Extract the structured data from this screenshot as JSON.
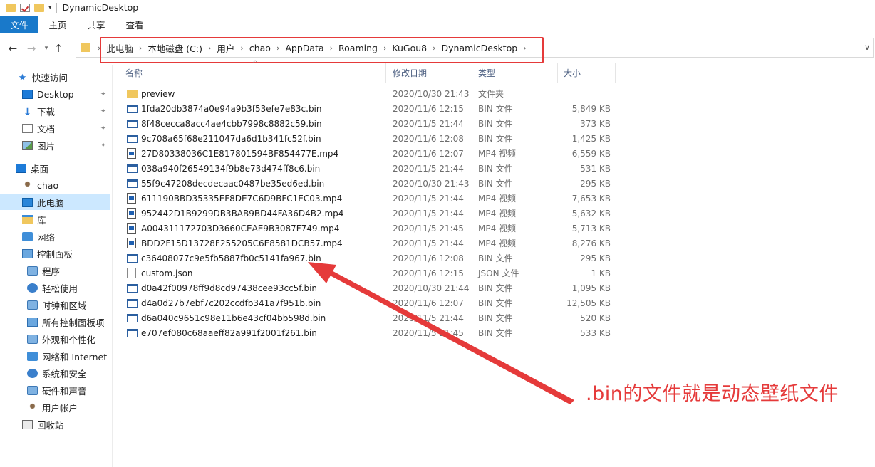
{
  "window": {
    "title": "DynamicDesktop"
  },
  "ribbon": {
    "tabs": [
      "文件",
      "主页",
      "共享",
      "查看"
    ]
  },
  "address": {
    "crumbs": [
      "此电脑",
      "本地磁盘 (C:)",
      "用户",
      "chao",
      "AppData",
      "Roaming",
      "KuGou8",
      "DynamicDesktop"
    ]
  },
  "sidebar": {
    "items": [
      "快速访问",
      "Desktop",
      "下载",
      "文档",
      "图片",
      "桌面",
      "chao",
      "此电脑",
      "库",
      "网络",
      "控制面板",
      "程序",
      "轻松使用",
      "时钟和区域",
      "所有控制面板项",
      "外观和个性化",
      "网络和 Internet",
      "系统和安全",
      "硬件和声音",
      "用户帐户",
      "回收站"
    ]
  },
  "columns": {
    "name": "名称",
    "date": "修改日期",
    "type": "类型",
    "size": "大小"
  },
  "files": [
    {
      "name": "preview",
      "date": "2020/10/30 21:43",
      "type": "文件夹",
      "size": "",
      "kind": "folder"
    },
    {
      "name": "1fda20db3874a0e94a9b3f53efe7e83c.bin",
      "date": "2020/11/6 12:15",
      "type": "BIN 文件",
      "size": "5,849 KB",
      "kind": "bin"
    },
    {
      "name": "8f48cecca8acc4ae4cbb7998c8882c59.bin",
      "date": "2020/11/5 21:44",
      "type": "BIN 文件",
      "size": "373 KB",
      "kind": "bin"
    },
    {
      "name": "9c708a65f68e211047da6d1b341fc52f.bin",
      "date": "2020/11/6 12:08",
      "type": "BIN 文件",
      "size": "1,425 KB",
      "kind": "bin"
    },
    {
      "name": "27D80338036C1E817801594BF854477E.mp4",
      "date": "2020/11/6 12:07",
      "type": "MP4 视频",
      "size": "6,559 KB",
      "kind": "mp4"
    },
    {
      "name": "038a940f26549134f9b8e73d474ff8c6.bin",
      "date": "2020/11/5 21:44",
      "type": "BIN 文件",
      "size": "531 KB",
      "kind": "bin"
    },
    {
      "name": "55f9c47208decdecaac0487be35ed6ed.bin",
      "date": "2020/10/30 21:43",
      "type": "BIN 文件",
      "size": "295 KB",
      "kind": "bin"
    },
    {
      "name": "611190BBD35335EF8DE7C6D9BFC1EC03.mp4",
      "date": "2020/11/5 21:44",
      "type": "MP4 视频",
      "size": "7,653 KB",
      "kind": "mp4"
    },
    {
      "name": "952442D1B9299DB3BAB9BD44FA36D4B2.mp4",
      "date": "2020/11/5 21:44",
      "type": "MP4 视频",
      "size": "5,632 KB",
      "kind": "mp4"
    },
    {
      "name": "A004311172703D3660CEAE9B3087F749.mp4",
      "date": "2020/11/5 21:45",
      "type": "MP4 视频",
      "size": "5,713 KB",
      "kind": "mp4"
    },
    {
      "name": "BDD2F15D13728F255205C6E8581DCB57.mp4",
      "date": "2020/11/5 21:44",
      "type": "MP4 视频",
      "size": "8,276 KB",
      "kind": "mp4"
    },
    {
      "name": "c36408077c9e5fb5887fb0c5141fa967.bin",
      "date": "2020/11/6 12:08",
      "type": "BIN 文件",
      "size": "295 KB",
      "kind": "bin"
    },
    {
      "name": "custom.json",
      "date": "2020/11/6 12:15",
      "type": "JSON 文件",
      "size": "1 KB",
      "kind": "json"
    },
    {
      "name": "d0a42f00978ff9d8cd97438cee93cc5f.bin",
      "date": "2020/10/30 21:44",
      "type": "BIN 文件",
      "size": "1,095 KB",
      "kind": "bin"
    },
    {
      "name": "d4a0d27b7ebf7c202ccdfb341a7f951b.bin",
      "date": "2020/11/6 12:07",
      "type": "BIN 文件",
      "size": "12,505 KB",
      "kind": "bin"
    },
    {
      "name": "d6a040c9651c98e11b6e43cf04bb598d.bin",
      "date": "2020/11/5 21:44",
      "type": "BIN 文件",
      "size": "520 KB",
      "kind": "bin"
    },
    {
      "name": "e707ef080c68aaeff82a991f2001f261.bin",
      "date": "2020/11/5 21:45",
      "type": "BIN 文件",
      "size": "533 KB",
      "kind": "bin"
    }
  ],
  "annotation": {
    "text": ".bin的文件就是动态壁纸文件",
    "color": "#e53a3a"
  },
  "colors": {
    "accent": "#1979ca",
    "selected": "#cce8ff",
    "folder": "#f0c75e"
  }
}
